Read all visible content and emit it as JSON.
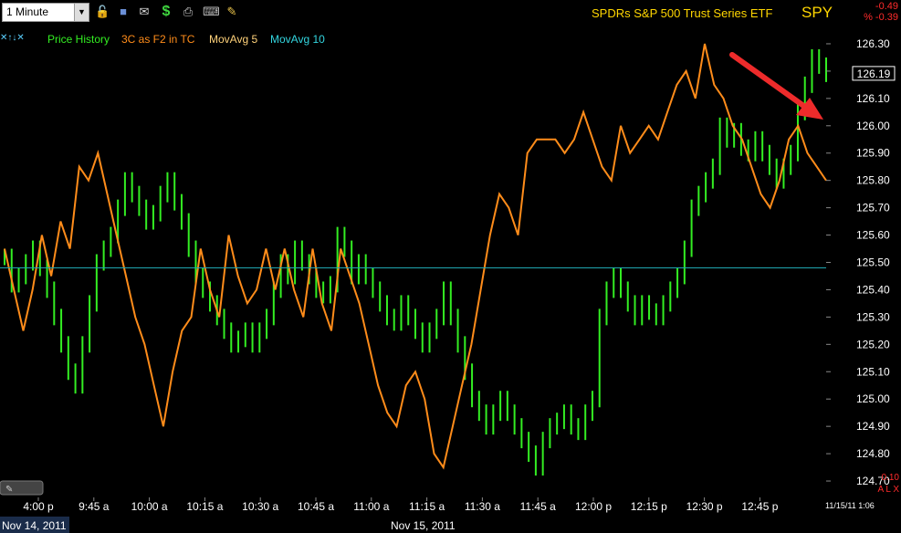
{
  "toolbar": {
    "interval": "1 Minute",
    "icons": [
      "lock-icon",
      "save-icon",
      "mail-icon",
      "dollar-icon",
      "print-icon",
      "keyboard-icon",
      "pencil-icon"
    ]
  },
  "header": {
    "title": "SPDRs S&P 500 Trust Series ETF",
    "symbol": "SPY",
    "change": "-0.49",
    "change_pct": "% -0.39"
  },
  "legend": {
    "arrows": "✕↑↓✕",
    "items": [
      {
        "label": "Price History",
        "color": "#33ee22"
      },
      {
        "label": "3C as F2 in TC",
        "color": "#ff8c1a"
      },
      {
        "label": "MovAvg 5",
        "color": "#ffd27a"
      },
      {
        "label": "MovAvg 10",
        "color": "#33d6e0"
      }
    ]
  },
  "footer": {
    "date_left": "Nov 14, 2011",
    "date_center": "Nov 15, 2011",
    "timestamp": "11/15/11 1:06",
    "indicator_value": "0.10",
    "indicator_label": "A L X"
  },
  "chart_data": {
    "type": "line",
    "title": "SPDRs S&P 500 Trust Series ETF",
    "ylim": [
      124.64,
      126.36
    ],
    "y_ticks": [
      124.7,
      124.8,
      124.9,
      125.0,
      125.1,
      125.2,
      125.3,
      125.4,
      125.5,
      125.6,
      125.7,
      125.8,
      125.9,
      126.0,
      126.1,
      126.2,
      126.3
    ],
    "y_tick_labels": [
      "124.70",
      "124.80",
      "124.90",
      "125.00",
      "125.10",
      "125.20",
      "125.30",
      "125.40",
      "125.50",
      "125.60",
      "125.70",
      "125.80",
      "125.90",
      "126.00",
      "126.10",
      "126.20",
      "126.30"
    ],
    "x_tick_labels": [
      "4:00 p",
      "9:45 a",
      "10:00 a",
      "10:15 a",
      "10:30 a",
      "10:45 a",
      "11:00 a",
      "11:15 a",
      "11:30 a",
      "11:45 a",
      "12:00 p",
      "12:15 p",
      "12:30 p",
      "12:45 p"
    ],
    "last_price": "126.19",
    "reference_line": 125.48,
    "grid": false,
    "series": [
      {
        "name": "Price History",
        "color": "#33ee22",
        "values": [
          125.52,
          125.42,
          125.45,
          125.5,
          125.55,
          125.48,
          125.4,
          125.3,
          125.2,
          125.1,
          125.05,
          125.2,
          125.35,
          125.5,
          125.55,
          125.6,
          125.7,
          125.8,
          125.75,
          125.7,
          125.65,
          125.68,
          125.75,
          125.8,
          125.72,
          125.65,
          125.55,
          125.45,
          125.4,
          125.35,
          125.3,
          125.25,
          125.2,
          125.22,
          125.25,
          125.2,
          125.25,
          125.3,
          125.4,
          125.5,
          125.45,
          125.55,
          125.5,
          125.45,
          125.4,
          125.38,
          125.42,
          125.6,
          125.55,
          125.45,
          125.5,
          125.45,
          125.4,
          125.35,
          125.3,
          125.28,
          125.35,
          125.3,
          125.25,
          125.2,
          125.25,
          125.3,
          125.4,
          125.3,
          125.2,
          125.1,
          125.0,
          124.95,
          124.9,
          124.95,
          125.0,
          124.95,
          124.9,
          124.85,
          124.8,
          124.75,
          124.85,
          124.9,
          124.92,
          124.95,
          124.9,
          124.88,
          124.95,
          125.0,
          125.3,
          125.4,
          125.45,
          125.4,
          125.35,
          125.3,
          125.35,
          125.32,
          125.3,
          125.35,
          125.4,
          125.45,
          125.55,
          125.7,
          125.75,
          125.8,
          125.85,
          126.0,
          125.95,
          125.98,
          125.92,
          125.9,
          125.95,
          125.9,
          125.85,
          125.8,
          125.85,
          125.9,
          126.05,
          126.15,
          126.25,
          126.22,
          126.19
        ]
      },
      {
        "name": "3C as F2 in TC",
        "color": "#ff8c1a",
        "values": [
          125.55,
          125.4,
          125.25,
          125.4,
          125.6,
          125.45,
          125.65,
          125.55,
          125.85,
          125.8,
          125.9,
          125.75,
          125.6,
          125.45,
          125.3,
          125.2,
          125.05,
          124.9,
          125.1,
          125.25,
          125.3,
          125.55,
          125.4,
          125.3,
          125.6,
          125.45,
          125.35,
          125.4,
          125.55,
          125.4,
          125.55,
          125.4,
          125.3,
          125.55,
          125.35,
          125.25,
          125.55,
          125.45,
          125.35,
          125.2,
          125.05,
          124.95,
          124.9,
          125.05,
          125.1,
          125.0,
          124.8,
          124.75,
          124.9,
          125.05,
          125.2,
          125.4,
          125.6,
          125.75,
          125.7,
          125.6,
          125.9,
          125.95,
          125.95,
          125.95,
          125.9,
          125.95,
          126.05,
          125.95,
          125.85,
          125.8,
          126.0,
          125.9,
          125.95,
          126.0,
          125.95,
          126.05,
          126.15,
          126.2,
          126.1,
          126.3,
          126.15,
          126.1,
          126.0,
          125.95,
          125.85,
          125.75,
          125.7,
          125.8,
          125.95,
          126.0,
          125.9,
          125.85,
          125.8
        ]
      }
    ]
  }
}
